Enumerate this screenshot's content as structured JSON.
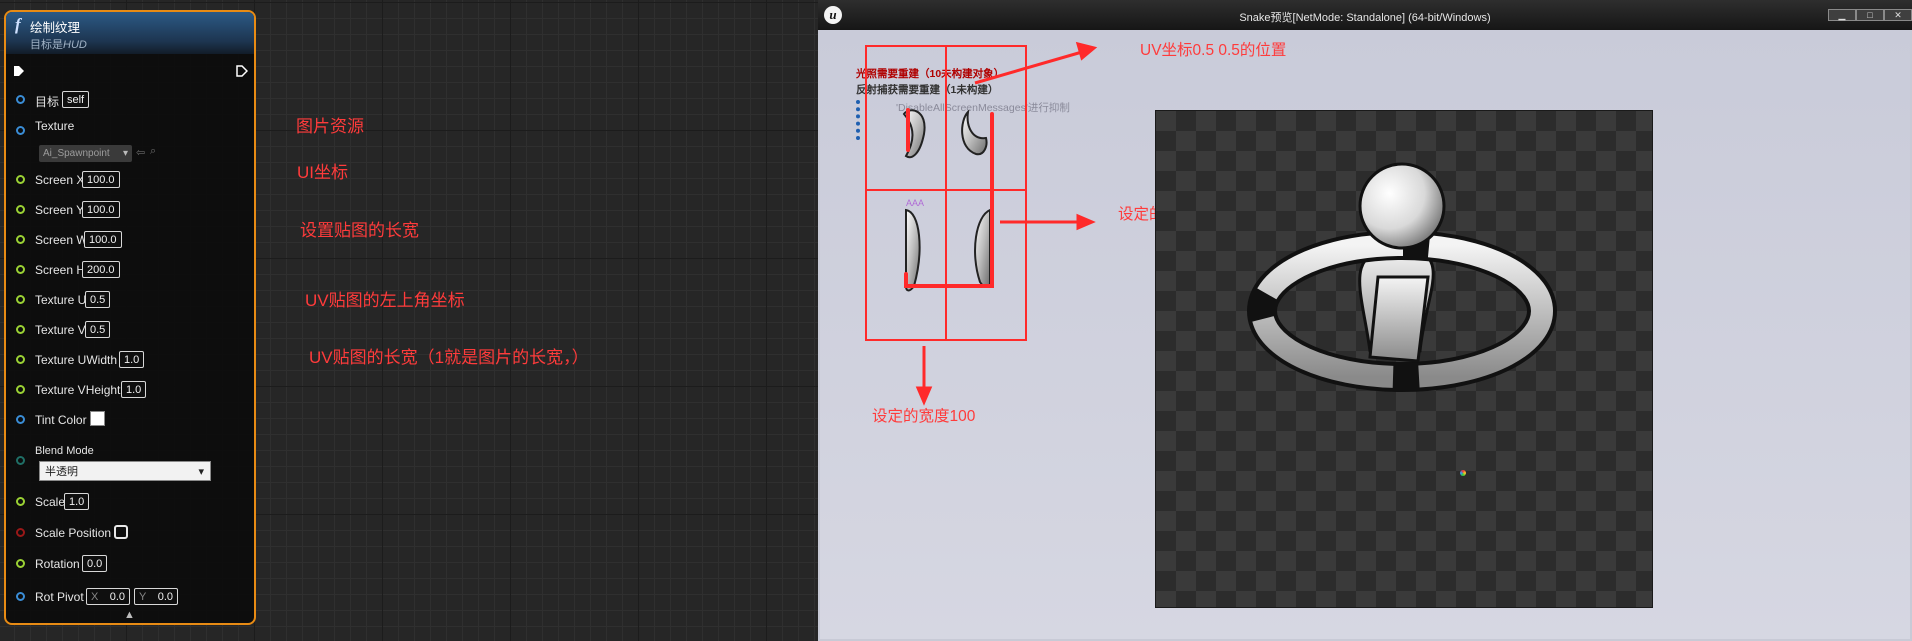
{
  "blueprint_node": {
    "icon": "function-f-icon",
    "title": "绘制纹理",
    "subtitle_prefix": "目标是",
    "subtitle_value": "HUD",
    "pins": {
      "target": {
        "label": "目标",
        "value": "self"
      },
      "texture": {
        "label": "Texture",
        "value": "Ai_Spawnpoint"
      },
      "screen_x": {
        "label": "Screen X",
        "value": "100.0"
      },
      "screen_y": {
        "label": "Screen Y",
        "value": "100.0"
      },
      "screen_w": {
        "label": "Screen W",
        "value": "100.0"
      },
      "screen_h": {
        "label": "Screen H",
        "value": "200.0"
      },
      "texture_u": {
        "label": "Texture U",
        "value": "0.5"
      },
      "texture_v": {
        "label": "Texture V",
        "value": "0.5"
      },
      "texture_uwidth": {
        "label": "Texture UWidth",
        "value": "1.0"
      },
      "texture_vheight": {
        "label": "Texture VHeight",
        "value": "1.0"
      },
      "tint_color": {
        "label": "Tint Color",
        "value": "#ffffff"
      },
      "blend_mode": {
        "label": "Blend Mode",
        "value": "半透明"
      },
      "scale": {
        "label": "Scale",
        "value": "1.0"
      },
      "scale_position": {
        "label": "Scale Position",
        "checked": false
      },
      "rotation": {
        "label": "Rotation",
        "value": "0.0"
      },
      "rot_pivot": {
        "label": "Rot Pivot",
        "x_label": "X",
        "x_value": "0.0",
        "y_label": "Y",
        "y_value": "0.0"
      }
    }
  },
  "annotations_left": {
    "image_resource": "图片资源",
    "ui_coords": "UI坐标",
    "set_size": "设置贴图的长宽",
    "uv_topleft": "UV贴图的左上角坐标",
    "uv_size": "UV贴图的长宽（1就是图片的长宽，）"
  },
  "preview_window": {
    "title": "Snake预览[NetMode: Standalone]  (64-bit/Windows)",
    "buttons": {
      "minimize": "▁",
      "maximize": "□",
      "close": "✕"
    },
    "debug_lines": {
      "line1": "光照需要重建（10未构建对象）",
      "line2": "反射捕获需要重建（1未构建）",
      "line3": "'DisableAllScreenMessages'进行抑制",
      "aaa": "AAA"
    },
    "annotations": {
      "uv_pos": "UV坐标0.5 0.5的位置",
      "height": "设定的高度200",
      "width": "设定的宽度100"
    }
  },
  "colors": {
    "node_border": "#e88b14",
    "annotation_red": "#ff3b3b",
    "pin_green": "#9bd234",
    "pin_blue": "#3a8dd6"
  }
}
